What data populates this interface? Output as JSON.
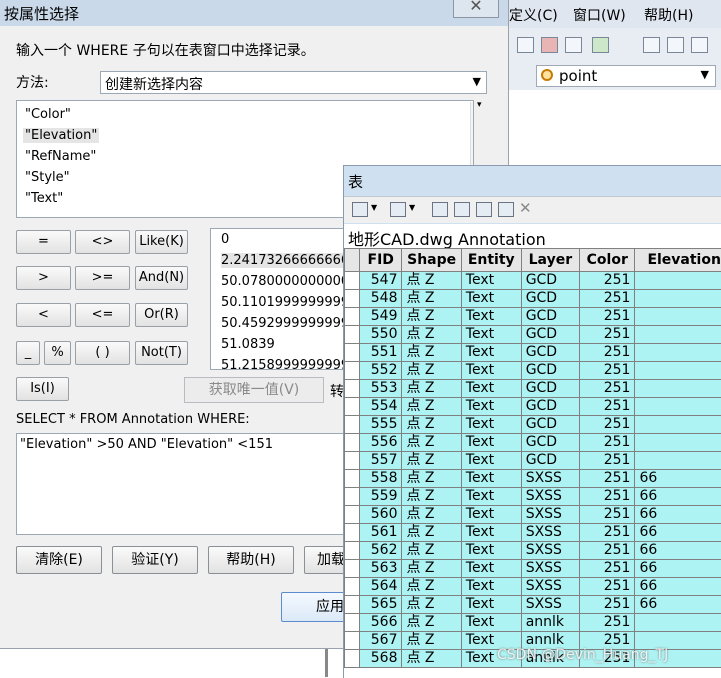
{
  "main_window": {
    "menus": [
      "定义(C)",
      "窗口(W)",
      "帮助(H)"
    ],
    "layer_select": {
      "value": "point"
    }
  },
  "dialog": {
    "title": "按属性选择",
    "close_label": "✕",
    "instruction": "输入一个 WHERE 子句以在表窗口中选择记录。",
    "method_label": "方法:",
    "method_value": "创建新选择内容",
    "fields": [
      "\"Color\"",
      "\"Elevation\"",
      "\"RefName\"",
      "\"Style\"",
      "\"Text\""
    ],
    "selected_field": "\"Elevation\"",
    "operators": {
      "eq": "=",
      "ne": "<>",
      "like": "Like(K)",
      "gt": ">",
      "ge": ">=",
      "and": "And(N)",
      "lt": "<",
      "le": "<=",
      "or": "Or(R)",
      "underscore": "_",
      "percent": "%",
      "parens": "( )",
      "not": "Not(T)",
      "is": "Is(I)"
    },
    "values": [
      "0",
      "2.2417326666666639",
      "50.078000000000003",
      "50.110199999999999",
      "50.459299999999999",
      "51.0839",
      "51.215899999999998"
    ],
    "unique_button": "获取唯一值(V)",
    "goto_label": "转",
    "sql_prefix": "SELECT * FROM Annotation WHERE:",
    "sql_expression": "\"Elevation\" >50 AND \"Elevation\" <151",
    "buttons": {
      "clear": "清除(E)",
      "verify": "验证(Y)",
      "help": "帮助(H)",
      "load": "加载",
      "apply": "应用"
    }
  },
  "table_window": {
    "title": "表",
    "caption": "地形CAD.dwg Annotation",
    "columns": [
      "FID",
      "Shape",
      "Entity",
      "Layer",
      "Color",
      "Elevation"
    ],
    "rows": [
      [
        "547",
        "点 Z",
        "Text",
        "GCD",
        "251",
        ""
      ],
      [
        "548",
        "点 Z",
        "Text",
        "GCD",
        "251",
        ""
      ],
      [
        "549",
        "点 Z",
        "Text",
        "GCD",
        "251",
        ""
      ],
      [
        "550",
        "点 Z",
        "Text",
        "GCD",
        "251",
        ""
      ],
      [
        "551",
        "点 Z",
        "Text",
        "GCD",
        "251",
        ""
      ],
      [
        "552",
        "点 Z",
        "Text",
        "GCD",
        "251",
        ""
      ],
      [
        "553",
        "点 Z",
        "Text",
        "GCD",
        "251",
        ""
      ],
      [
        "554",
        "点 Z",
        "Text",
        "GCD",
        "251",
        ""
      ],
      [
        "555",
        "点 Z",
        "Text",
        "GCD",
        "251",
        ""
      ],
      [
        "556",
        "点 Z",
        "Text",
        "GCD",
        "251",
        ""
      ],
      [
        "557",
        "点 Z",
        "Text",
        "GCD",
        "251",
        ""
      ],
      [
        "558",
        "点 Z",
        "Text",
        "SXSS",
        "251",
        "66"
      ],
      [
        "559",
        "点 Z",
        "Text",
        "SXSS",
        "251",
        "66"
      ],
      [
        "560",
        "点 Z",
        "Text",
        "SXSS",
        "251",
        "66"
      ],
      [
        "561",
        "点 Z",
        "Text",
        "SXSS",
        "251",
        "66"
      ],
      [
        "562",
        "点 Z",
        "Text",
        "SXSS",
        "251",
        "66"
      ],
      [
        "563",
        "点 Z",
        "Text",
        "SXSS",
        "251",
        "66"
      ],
      [
        "564",
        "点 Z",
        "Text",
        "SXSS",
        "251",
        "66"
      ],
      [
        "565",
        "点 Z",
        "Text",
        "SXSS",
        "251",
        "66"
      ],
      [
        "566",
        "点 Z",
        "Text",
        "annlk",
        "251",
        ""
      ],
      [
        "567",
        "点 Z",
        "Text",
        "annlk",
        "251",
        ""
      ],
      [
        "568",
        "点 Z",
        "Text",
        "annlk",
        "251",
        ""
      ]
    ]
  },
  "watermark": "CSDN @Devin_Huang_TJ",
  "colors": {
    "selected_row": "#aef3f3",
    "dialog_bg": "#f0f0f0",
    "title_bar": "#cad9ea"
  },
  "icons": [
    "table-options-icon",
    "related-tables-icon",
    "select-by-attributes-icon",
    "switch-selection-icon",
    "clear-selection-icon",
    "zoom-to-selected-icon",
    "delete-selected-icon"
  ]
}
